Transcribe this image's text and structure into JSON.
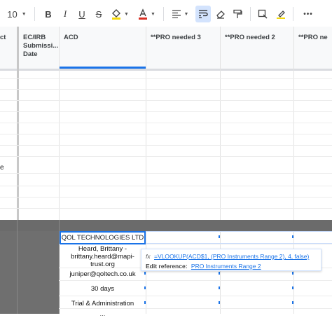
{
  "toolbar": {
    "font_size": "10",
    "more_label": "•••"
  },
  "columns": {
    "c0": "ct",
    "c1_lines": [
      "EC/IRB",
      "Submissi...",
      "Date"
    ],
    "c2": "ACD",
    "c3": "**PRO needed 3",
    "c4": "**PRO needed 2",
    "c5": "**PRO ne"
  },
  "left_fragment": "e",
  "cells": {
    "selected": "QOL TECHNOLOGIES LTD",
    "contact_lines": [
      "Heard, Brittany -",
      "brittany.heard@mapi-",
      "trust.org"
    ],
    "email": "juniper@qoltech.co.uk",
    "days": "30 days",
    "category": "Trial & Administration",
    "bottom_partial": "..."
  },
  "formula_tip": {
    "fx": "fx",
    "formula": "=VLOOKUP(ACD$1, (PRO Instruments Range 2), 4, false)",
    "edit_label": "Edit reference:",
    "ref": "PRO Instruments Range 2"
  },
  "colors": {
    "accent": "#1a73e8",
    "dark_band": "#6b6b6b"
  }
}
